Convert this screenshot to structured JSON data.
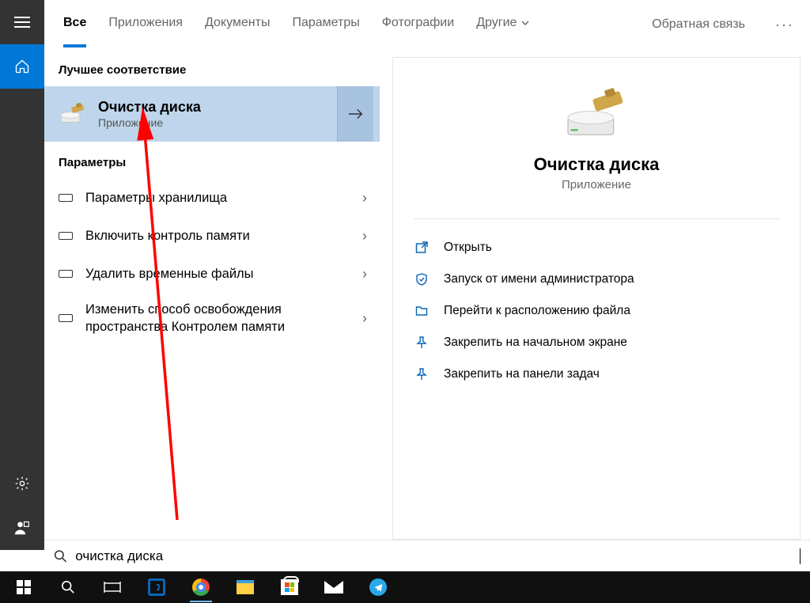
{
  "tabs": {
    "items": [
      {
        "label": "Все",
        "active": true
      },
      {
        "label": "Приложения"
      },
      {
        "label": "Документы"
      },
      {
        "label": "Параметры"
      },
      {
        "label": "Фотографии"
      },
      {
        "label": "Другие",
        "dropdown": true
      }
    ],
    "feedback": "Обратная связь"
  },
  "results": {
    "best_header": "Лучшее соответствие",
    "best_match": {
      "title": "Очистка диска",
      "subtitle": "Приложение"
    },
    "params_header": "Параметры",
    "params": [
      {
        "label": "Параметры хранилища"
      },
      {
        "label": "Включить контроль памяти"
      },
      {
        "label": "Удалить временные файлы"
      },
      {
        "label": "Изменить способ освобождения пространства Контролем памяти"
      }
    ]
  },
  "preview": {
    "title": "Очистка диска",
    "subtitle": "Приложение",
    "actions": [
      {
        "label": "Открыть",
        "icon": "open"
      },
      {
        "label": "Запуск от имени администратора",
        "icon": "admin"
      },
      {
        "label": "Перейти к расположению файла",
        "icon": "folder"
      },
      {
        "label": "Закрепить на начальном экране",
        "icon": "pin"
      },
      {
        "label": "Закрепить на панели задач",
        "icon": "pin"
      }
    ]
  },
  "search": {
    "query": "очистка диска"
  }
}
